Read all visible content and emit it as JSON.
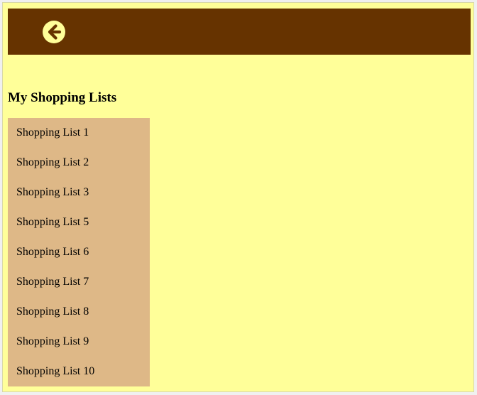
{
  "header": {
    "back_icon": "arrow-left-circle-icon",
    "background_color": "#663300",
    "icon_color": "#ffff99"
  },
  "page": {
    "title": "My Shopping Lists",
    "background_color": "#ffff99"
  },
  "lists": {
    "background_color": "#deb887",
    "items": [
      {
        "label": "Shopping List 1"
      },
      {
        "label": "Shopping List 2"
      },
      {
        "label": "Shopping List 3"
      },
      {
        "label": "Shopping List 5"
      },
      {
        "label": "Shopping List 6"
      },
      {
        "label": "Shopping List 7"
      },
      {
        "label": "Shopping List 8"
      },
      {
        "label": "Shopping List 9"
      },
      {
        "label": "Shopping List 10"
      }
    ]
  }
}
